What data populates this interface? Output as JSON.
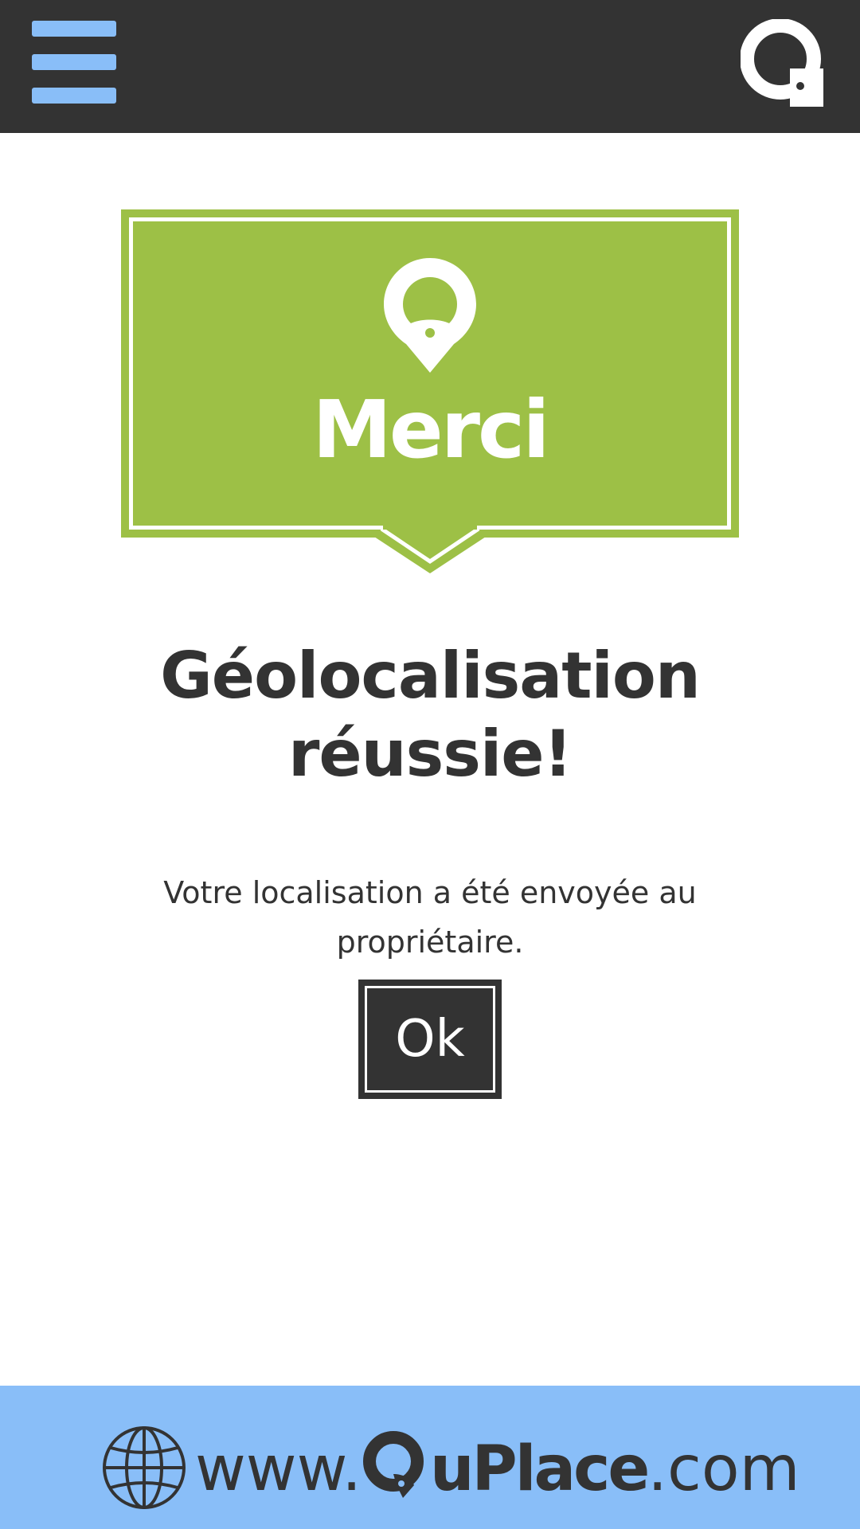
{
  "header": {
    "menu_icon": "hamburger-menu-icon",
    "logo_icon": "quplace-q-logo-icon",
    "background_color": "#333333",
    "menu_color": "#89BEF8"
  },
  "banner": {
    "title": "Merci",
    "icon": "location-pin-icon",
    "color": "#9DC046"
  },
  "content": {
    "headline_line1": "Géolocalisation",
    "headline_line2": "réussie!",
    "message": "Votre localisation a été envoyée au propriétaire.",
    "ok_label": "Ok"
  },
  "footer": {
    "globe_icon": "globe-icon",
    "url_prefix": "www.",
    "brand_rest": "uPlace",
    "url_suffix": ".com",
    "background_color": "#89BEF8"
  }
}
